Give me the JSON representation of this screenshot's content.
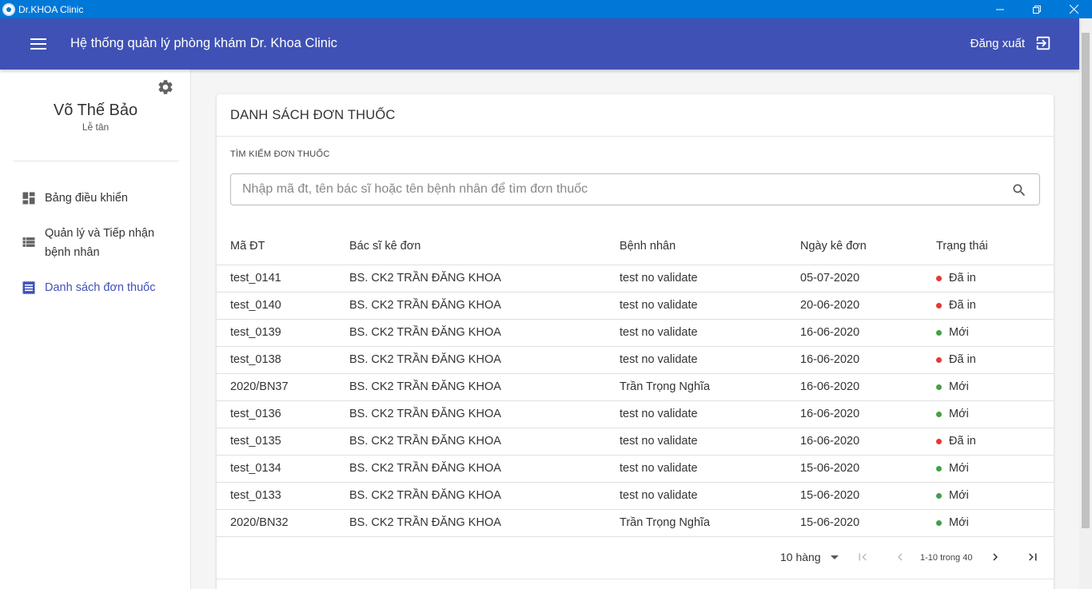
{
  "window": {
    "title": "Dr.KHOA Clinic",
    "minimize": "—",
    "restore": "❐",
    "close": "✕"
  },
  "appbar": {
    "title": "Hệ thống quản lý phòng khám Dr. Khoa Clinic",
    "logout_label": "Đăng xuất"
  },
  "user": {
    "name": "Võ Thế Bảo",
    "role": "Lễ tân"
  },
  "nav": [
    {
      "label": "Bảng điều khiển",
      "icon": "dashboard-icon"
    },
    {
      "label": "Quản lý và Tiếp nhận bệnh nhân",
      "icon": "list-icon"
    },
    {
      "label": "Danh sách đơn thuốc",
      "icon": "receipt-icon",
      "active": true
    }
  ],
  "card": {
    "title": "DANH SÁCH ĐƠN THUỐC",
    "search_label": "TÌM KIẾM ĐƠN THUỐC",
    "search_placeholder": "Nhập mã đt, tên bác sĩ hoặc tên bệnh nhân để tìm đơn thuốc"
  },
  "table": {
    "headers": [
      "Mã ĐT",
      "Bác sĩ kê đơn",
      "Bệnh nhân",
      "Ngày kê đơn",
      "Trạng thái"
    ],
    "rows": [
      {
        "id": "test_0141",
        "doctor": "BS. CK2 TRẦN ĐĂNG KHOA",
        "patient": "test no validate",
        "date": "05-07-2020",
        "status": "Đã in"
      },
      {
        "id": "test_0140",
        "doctor": "BS. CK2 TRẦN ĐĂNG KHOA",
        "patient": "test no validate",
        "date": "20-06-2020",
        "status": "Đã in"
      },
      {
        "id": "test_0139",
        "doctor": "BS. CK2 TRẦN ĐĂNG KHOA",
        "patient": "test no validate",
        "date": "16-06-2020",
        "status": "Mới"
      },
      {
        "id": "test_0138",
        "doctor": "BS. CK2 TRẦN ĐĂNG KHOA",
        "patient": "test no validate",
        "date": "16-06-2020",
        "status": "Đã in"
      },
      {
        "id": "2020/BN37",
        "doctor": "BS. CK2 TRẦN ĐĂNG KHOA",
        "patient": "Trần Trọng Nghĩa",
        "date": "16-06-2020",
        "status": "Mới"
      },
      {
        "id": "test_0136",
        "doctor": "BS. CK2 TRẦN ĐĂNG KHOA",
        "patient": "test no validate",
        "date": "16-06-2020",
        "status": "Mới"
      },
      {
        "id": "test_0135",
        "doctor": "BS. CK2 TRẦN ĐĂNG KHOA",
        "patient": "test no validate",
        "date": "16-06-2020",
        "status": "Đã in"
      },
      {
        "id": "test_0134",
        "doctor": "BS. CK2 TRẦN ĐĂNG KHOA",
        "patient": "test no validate",
        "date": "15-06-2020",
        "status": "Mới"
      },
      {
        "id": "test_0133",
        "doctor": "BS. CK2 TRẦN ĐĂNG KHOA",
        "patient": "test no validate",
        "date": "15-06-2020",
        "status": "Mới"
      },
      {
        "id": "2020/BN32",
        "doctor": "BS. CK2 TRẦN ĐĂNG KHOA",
        "patient": "Trần Trọng Nghĩa",
        "date": "15-06-2020",
        "status": "Mới"
      }
    ]
  },
  "status_colors": {
    "Đã in": "#e53935",
    "Mới": "#43a047"
  },
  "pager": {
    "rows_per_page": "10 hàng",
    "range": "1-10 trong 40"
  },
  "colors": {
    "titlebar": "#0078d7",
    "appbar": "#3f51b5",
    "link": "#5b2a86",
    "link_visited_alt": "#1a1aa6"
  }
}
